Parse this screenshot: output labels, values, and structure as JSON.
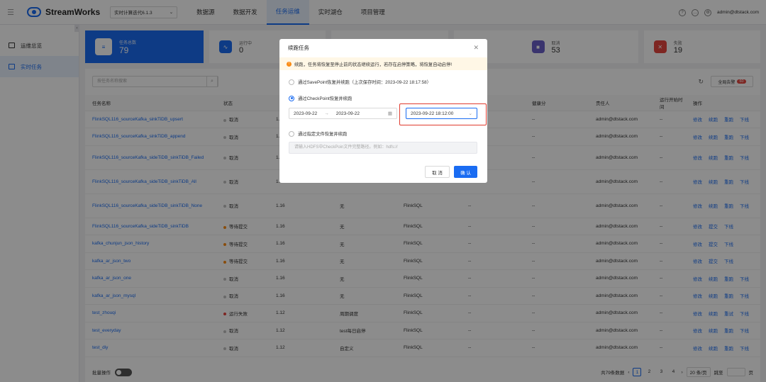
{
  "app": {
    "name": "StreamWorks",
    "project": "实时计算迭代6.1.3",
    "user": "admin@dtstack.com"
  },
  "nav": [
    "数据源",
    "数据开发",
    "任务运维",
    "实时湖仓",
    "项目管理"
  ],
  "sidebar": [
    "运维总览",
    "实时任务"
  ],
  "stats": [
    {
      "label": "任务总数",
      "value": "79"
    },
    {
      "label": "运行中",
      "value": "0"
    },
    {
      "label": "取消",
      "value": "53"
    },
    {
      "label": "失败",
      "value": "19"
    }
  ],
  "search_placeholder": "按任务名称搜索",
  "alarm": {
    "label": "全局告警",
    "count": "60"
  },
  "table": {
    "headers": [
      "任务名称",
      "状态",
      "",
      "",
      "",
      "",
      "",
      "健康分",
      "责任人",
      "运行开始时间",
      "操作"
    ],
    "rows": [
      {
        "name": "FlinkSQL116_sourceKafka_sinkTiDB_upsert",
        "status": "取消",
        "ver": "1.",
        "mode": "",
        "type": "",
        "x": "",
        "score": "--",
        "owner": "admin@dtstack.com",
        "start": "--",
        "ops": [
          "修改",
          "续跑",
          "重跑",
          "下线"
        ]
      },
      {
        "name": "FlinkSQL116_sourceKafka_sinkTiDB_append",
        "status": "取消",
        "ver": "1.",
        "mode": "",
        "type": "",
        "x": "",
        "score": "--",
        "owner": "admin@dtstack.com",
        "start": "--",
        "ops": [
          "修改",
          "续跑",
          "重跑",
          "下线"
        ]
      },
      {
        "name": "FlinkSQL116_sourceKafka_sideTiDB_sinkTiDB_Failed",
        "status": "取消",
        "ver": "1.",
        "mode": "",
        "type": "",
        "x": "",
        "score": "--",
        "owner": "admin@dtstack.com",
        "start": "--",
        "ops": [
          "修改",
          "续跑",
          "重跑",
          "下线"
        ]
      },
      {
        "name": "FlinkSQL116_sourceKafka_sideTiDB_sinkTiDB_All",
        "status": "取消",
        "ver": "1.",
        "mode": "",
        "type": "",
        "x": "",
        "score": "--",
        "owner": "admin@dtstack.com",
        "start": "--",
        "ops": [
          "修改",
          "续跑",
          "重跑",
          "下线"
        ]
      },
      {
        "name": "FlinkSQL116_sourceKafka_sideTiDB_sinkTiDB_None",
        "status": "取消",
        "ver": "1.16",
        "mode": "无",
        "type": "FlinkSQL",
        "x": "--",
        "score": "--",
        "owner": "admin@dtstack.com",
        "start": "--",
        "ops": [
          "修改",
          "续跑",
          "重跑",
          "下线"
        ]
      },
      {
        "name": "FlinkSQL116_sourceKafka_sideTiDB_sinkTiDB",
        "status": "等待提交",
        "ver": "1.16",
        "mode": "无",
        "type": "FlinkSQL",
        "x": "--",
        "score": "--",
        "owner": "admin@dtstack.com",
        "start": "--",
        "ops": [
          "修改",
          "提交",
          "下线"
        ]
      },
      {
        "name": "kafka_chunjun_json_history",
        "status": "等待提交",
        "ver": "1.16",
        "mode": "无",
        "type": "FlinkSQL",
        "x": "--",
        "score": "--",
        "owner": "admin@dtstack.com",
        "start": "--",
        "ops": [
          "修改",
          "提交",
          "下线"
        ]
      },
      {
        "name": "kafka_ar_json_two",
        "status": "等待提交",
        "ver": "1.16",
        "mode": "无",
        "type": "FlinkSQL",
        "x": "--",
        "score": "--",
        "owner": "admin@dtstack.com",
        "start": "--",
        "ops": [
          "修改",
          "提交",
          "下线"
        ]
      },
      {
        "name": "kafka_ar_json_one",
        "status": "取消",
        "ver": "1.16",
        "mode": "无",
        "type": "FlinkSQL",
        "x": "--",
        "score": "--",
        "owner": "admin@dtstack.com",
        "start": "--",
        "ops": [
          "修改",
          "续跑",
          "重跑",
          "下线"
        ]
      },
      {
        "name": "kafka_ar_json_mysql",
        "status": "取消",
        "ver": "1.16",
        "mode": "无",
        "type": "FlinkSQL",
        "x": "--",
        "score": "--",
        "owner": "admin@dtstack.com",
        "start": "--",
        "ops": [
          "修改",
          "续跑",
          "重跑",
          "下线"
        ]
      },
      {
        "name": "test_zhouqi",
        "status": "运行失败",
        "ver": "1.12",
        "mode": "周期调度",
        "type": "FlinkSQL",
        "x": "--",
        "score": "--",
        "owner": "admin@dtstack.com",
        "start": "--",
        "ops": [
          "修改",
          "续跑",
          "重试",
          "下线"
        ]
      },
      {
        "name": "test_everyday",
        "status": "取消",
        "ver": "1.12",
        "mode": "test每日启停",
        "type": "FlinkSQL",
        "x": "--",
        "score": "--",
        "owner": "admin@dtstack.com",
        "start": "--",
        "ops": [
          "修改",
          "续跑",
          "重跑",
          "下线"
        ]
      },
      {
        "name": "test_diy",
        "status": "取消",
        "ver": "1.12",
        "mode": "自定义",
        "type": "FlinkSQL",
        "x": "--",
        "score": "--",
        "owner": "admin@dtstack.com",
        "start": "--",
        "ops": [
          "修改",
          "续跑",
          "重跑",
          "下线"
        ]
      }
    ],
    "status_colors": {
      "取消": "#bfbfbf",
      "等待提交": "#fa8c16",
      "运行失败": "#e5453f"
    }
  },
  "footer": {
    "batch": "批量操作",
    "total": "共79条数据",
    "pages": [
      "1",
      "2",
      "3",
      "4"
    ],
    "size": "20 条/页",
    "goto": "跳至",
    "page_unit": "页"
  },
  "modal": {
    "title": "续跑任务",
    "warning": "续跑，任务将恢复至停止前的状态继续运行，若存在启停策略，将恢复自动启停!",
    "option1": "通过SavePoint恢复并续跑（上次保存时间：2023-09-22 18:17:58）",
    "option2": "通过CheckPoint恢复并续跑",
    "range_start": "2023-09-22",
    "range_end": "2023-09-22",
    "checkpoint": "2023-09-22 18:12:00",
    "option3": "通过指定文件恢复并续跑",
    "path_placeholder": "请输入HDFS中CheckPoin文件完整路径。例如：hdfs://",
    "cancel": "取 消",
    "confirm": "确 认"
  }
}
